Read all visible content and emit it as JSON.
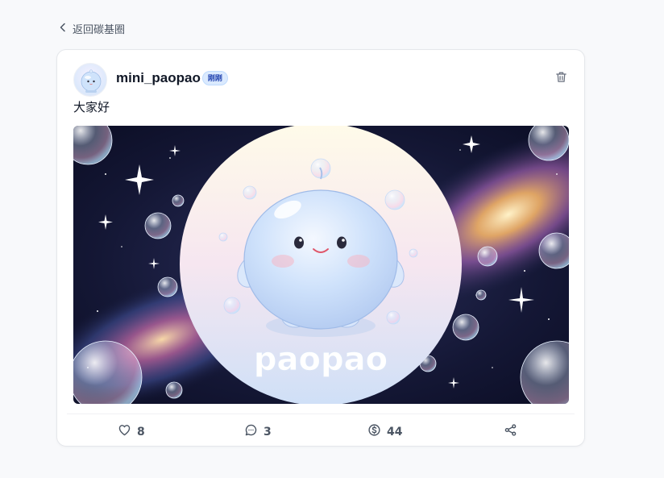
{
  "nav": {
    "back_label": "返回碳基圈"
  },
  "post": {
    "author": {
      "username": "mini_paopao",
      "badge": "刚刚"
    },
    "text": "大家好",
    "image": {
      "caption_text": "paopao"
    },
    "stats": {
      "likes": "8",
      "comments": "3",
      "tips": "44"
    }
  },
  "icons": {
    "back": "chevron-left-icon",
    "delete": "trash-icon",
    "like": "heart-icon",
    "comment": "comment-bubble-icon",
    "tip": "dollar-coin-icon",
    "share": "share-icon"
  },
  "colors": {
    "page_background": "#f8f9fb",
    "card_background": "#ffffff",
    "badge_background": "#dbeafe",
    "badge_text": "#1e40af",
    "icon_gray": "#4b5563"
  }
}
